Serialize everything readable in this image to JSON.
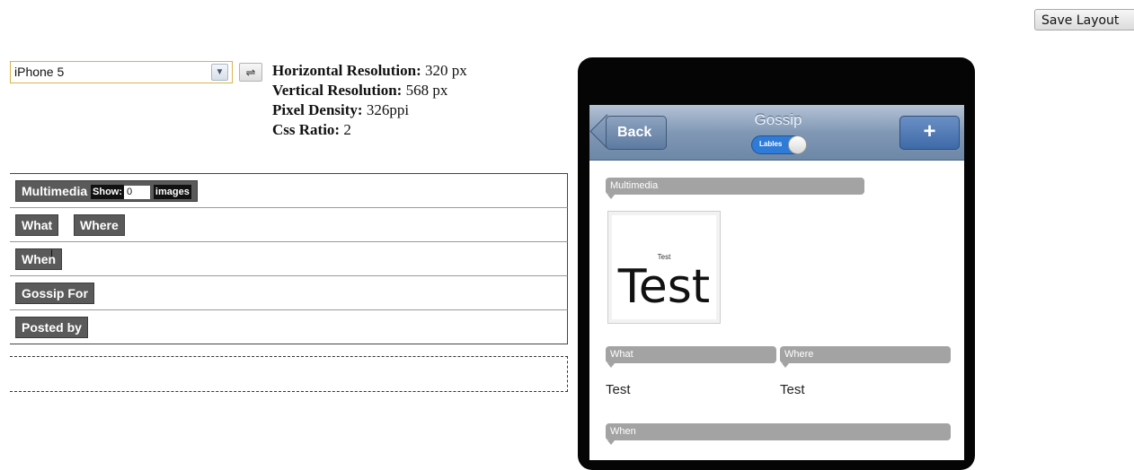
{
  "toolbar": {
    "save_label": "Save Layout"
  },
  "device": {
    "selected": "iPhone 5",
    "swap_symbol": "⇌",
    "info": [
      {
        "label": "Horizontal Resolution:",
        "value": "320 px"
      },
      {
        "label": "Vertical Resolution:",
        "value": "568 px"
      },
      {
        "label": "Pixel Density:",
        "value": "326ppi"
      },
      {
        "label": "Css Ratio:",
        "value": "2"
      }
    ]
  },
  "layout": {
    "rows": [
      {
        "tags": [
          "Multimedia"
        ],
        "show_label": "Show:",
        "show_value": "0",
        "images_label": "images"
      },
      {
        "tags": [
          "What",
          "Where"
        ]
      },
      {
        "tags": [
          "When"
        ]
      },
      {
        "tags": [
          "Gossip For"
        ]
      },
      {
        "tags": [
          "Posted by"
        ]
      }
    ]
  },
  "phone": {
    "back_label": "Back",
    "title": "Gossip",
    "toggle_label": "Lables",
    "plus_label": "+",
    "sections": {
      "multimedia": "Multimedia",
      "what": "What",
      "where": "Where",
      "when": "When"
    },
    "thumb_small": "Test",
    "thumb_big": "Test",
    "what_value": "Test",
    "where_value": "Test"
  }
}
